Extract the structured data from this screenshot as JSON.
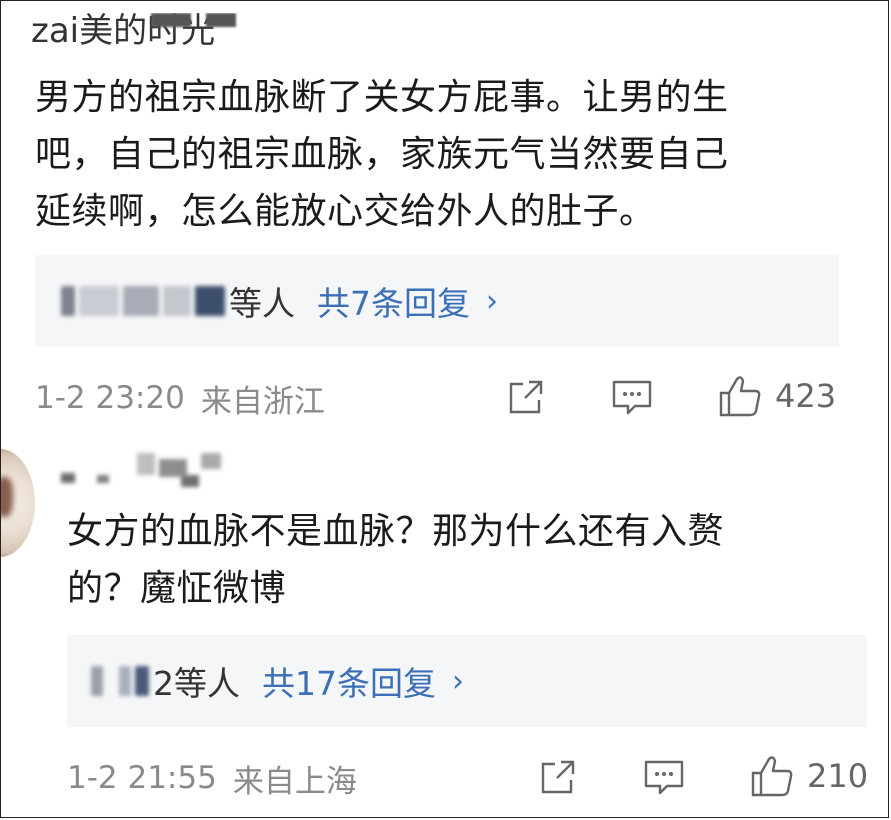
{
  "comment1": {
    "cut_name": "zai美的时光",
    "lines": [
      "男方的祖宗血脉断了关女方屁事。让男的生",
      "吧，自己的祖宗血脉，家族元气当然要自己",
      "延续啊，怎么能放心交给外人的肚子。"
    ],
    "replies": {
      "who_suffix": "等人",
      "count_text": "共7条回复",
      "chevron": "›"
    },
    "time": "1-2 23:20",
    "location": "来自浙江",
    "likes": "423"
  },
  "comment2": {
    "lines": [
      "女方的血脉不是血脉？那为什么还有入赘",
      "的？魔怔微博"
    ],
    "replies": {
      "who_suffix": "2等人",
      "count_text": "共17条回复",
      "chevron": "›"
    },
    "time": "1-2 21:55",
    "location": "来自上海",
    "likes": "210"
  },
  "colors": {
    "link_blue": "#3b6fb6",
    "meta_gray": "#8a8a8a",
    "reply_bg": "#f5f6f8"
  },
  "icons": [
    "share-icon",
    "comment-icon",
    "like-icon"
  ]
}
